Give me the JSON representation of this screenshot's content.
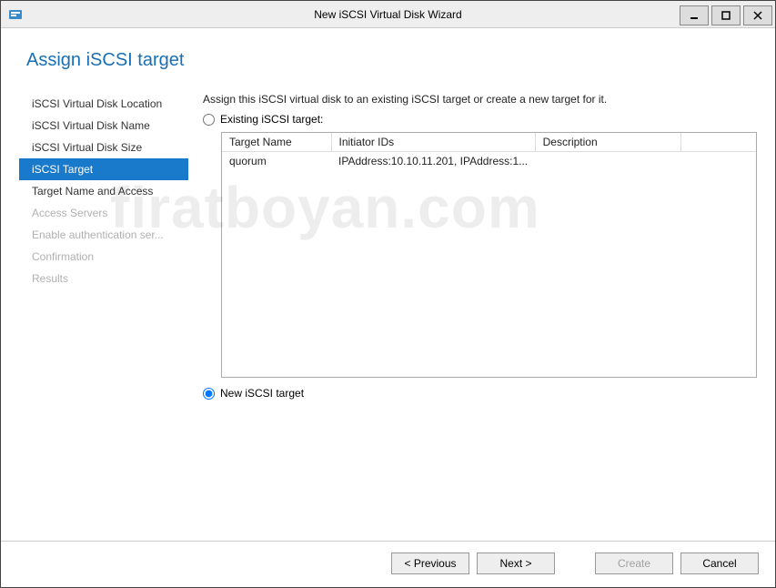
{
  "window": {
    "title": "New iSCSI Virtual Disk Wizard"
  },
  "page": {
    "heading": "Assign iSCSI target"
  },
  "sidebar": {
    "items": [
      {
        "label": "iSCSI Virtual Disk Location",
        "state": "normal"
      },
      {
        "label": "iSCSI Virtual Disk Name",
        "state": "normal"
      },
      {
        "label": "iSCSI Virtual Disk Size",
        "state": "normal"
      },
      {
        "label": "iSCSI Target",
        "state": "selected"
      },
      {
        "label": "Target Name and Access",
        "state": "normal"
      },
      {
        "label": "Access Servers",
        "state": "disabled"
      },
      {
        "label": "Enable authentication ser...",
        "state": "disabled"
      },
      {
        "label": "Confirmation",
        "state": "disabled"
      },
      {
        "label": "Results",
        "state": "disabled"
      }
    ]
  },
  "main": {
    "instruction": "Assign this iSCSI virtual disk to an existing iSCSI target or create a new target for it.",
    "existing_label": "Existing iSCSI target:",
    "new_label": "New iSCSI target",
    "selected_option": "new",
    "columns": {
      "target_name": "Target Name",
      "initiator_ids": "Initiator IDs",
      "description": "Description"
    },
    "rows": [
      {
        "target_name": "quorum",
        "initiator_ids": "IPAddress:10.10.11.201, IPAddress:1...",
        "description": ""
      }
    ]
  },
  "footer": {
    "previous": "< Previous",
    "next": "Next >",
    "create": "Create",
    "cancel": "Cancel"
  },
  "watermark": "firatboyan.com"
}
